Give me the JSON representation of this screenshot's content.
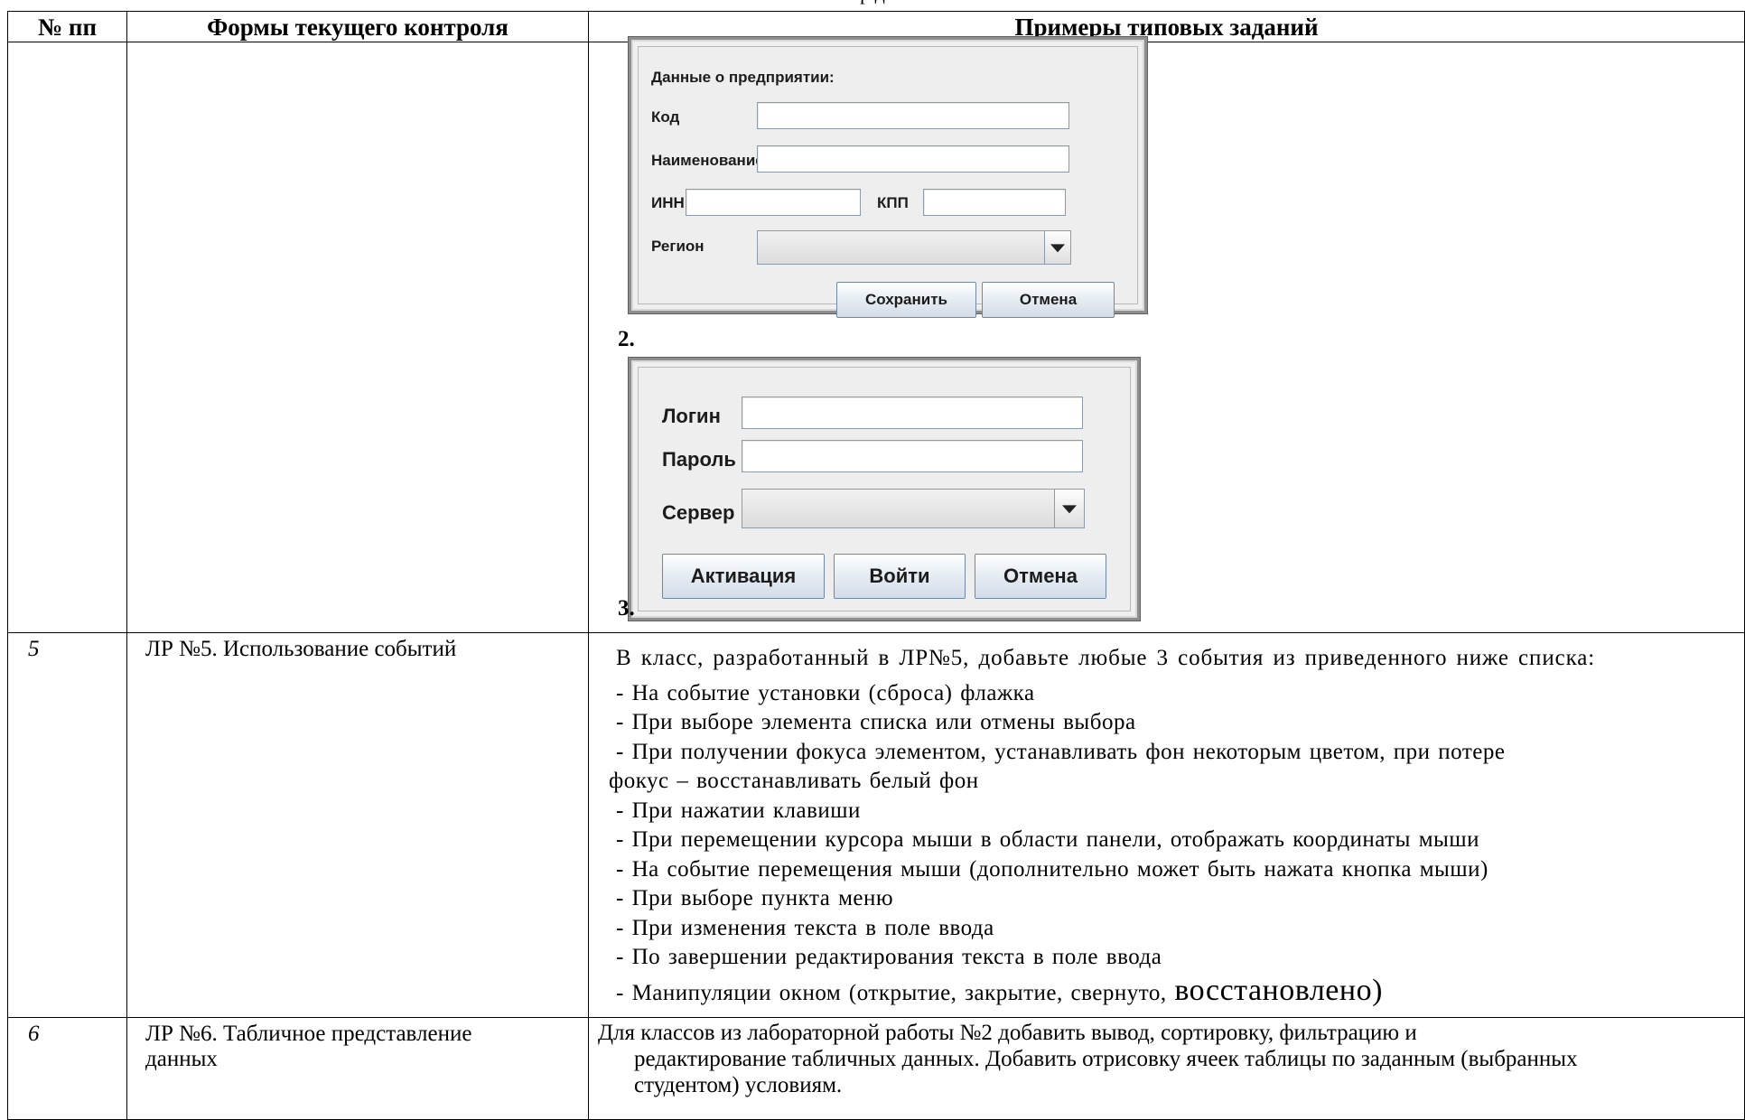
{
  "page_fragment": "р д",
  "headers": [
    "№ пп",
    "Формы текущего контроля",
    "Примеры типовых заданий"
  ],
  "dialog2": {
    "number": "2.",
    "section_title": "Данные о предприятии:",
    "label_code": "Код",
    "label_name": "Наименование",
    "label_inn": "ИНН",
    "label_kpp": "КПП",
    "label_region": "Регион",
    "btn_save": "Сохранить",
    "btn_cancel": "Отмена"
  },
  "dialog3": {
    "number": "3.",
    "label_login": "Логин",
    "label_password": "Пароль",
    "label_server": "Сервер",
    "btn_activate": "Активация",
    "btn_login": "Войти",
    "btn_cancel": "Отмена"
  },
  "row5": {
    "number": "5",
    "form": "ЛР №5. Использование событий",
    "intro": "В класс, разработанный в ЛР№5, добавьте любые 3 события из приведенного ниже списка:",
    "items": [
      "-  На событие установки (сброса) флажка",
      "-  При выборе элемента списка или отмены выбора",
      "-  При получении фокуса элементом, устанавливать фон некоторым цветом, при потере",
      "фокус – восстанавливать белый фон",
      "-  При нажатии клавиши",
      "-  При перемещении курсора мыши в области панели, отображать координаты мыши",
      "-  На событие перемещения мыши (дополнительно может быть нажата кнопка мыши)",
      "-  При выборе пункта меню",
      "-  При изменения текста в поле ввода",
      "-  По завершении редактирования текста в поле ввода"
    ],
    "last_item_part1": "-  Манипуляции окном (открытие, закрытие, свернуто, ",
    "last_item_part2": "восстановлено)"
  },
  "row6": {
    "number": "6",
    "form_line1": "ЛР №6. Табличное представление",
    "form_line2": "данных",
    "task_line1": "Для классов из лабораторной работы №2 добавить вывод, сортировку, фильтрацию и",
    "task_line2": "редактирование табличных данных. Добавить отрисовку ячеек таблицы по заданным (выбранных",
    "task_line3": "студентом) условиям."
  }
}
